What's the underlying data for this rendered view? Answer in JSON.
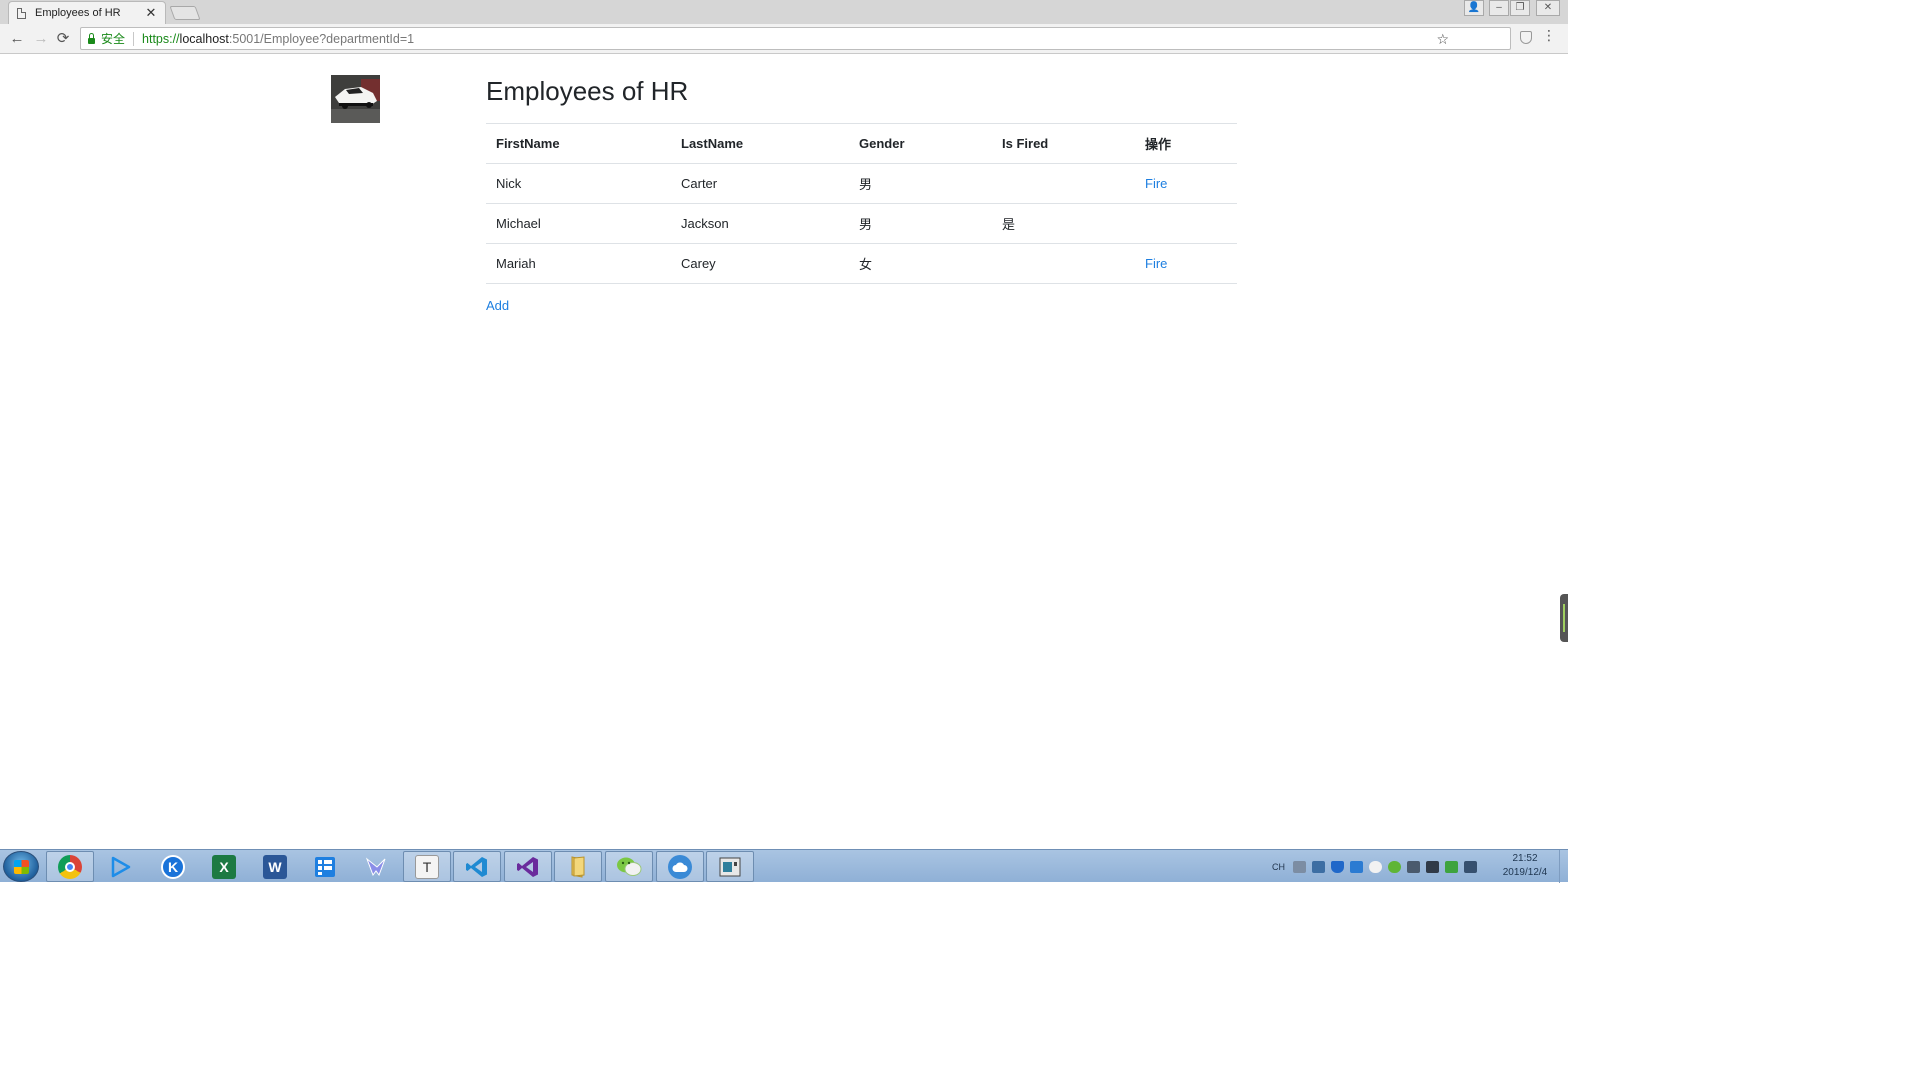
{
  "browser": {
    "tab_title": "Employees of HR",
    "tab_close": "✕",
    "secure_label": "安全",
    "url_scheme": "https://",
    "url_host": "localhost",
    "url_path": ":5001/Employee?departmentId=1",
    "back": "←",
    "forward": "→",
    "reload": "⟳",
    "star": "☆",
    "menu": "⋮",
    "window_controls": [
      "👤",
      "–",
      "❐",
      "✕"
    ]
  },
  "page": {
    "title": "Employees of HR",
    "table": {
      "headers": [
        "FirstName",
        "LastName",
        "Gender",
        "Is Fired",
        "操作"
      ],
      "rows": [
        {
          "first": "Nick",
          "last": "Carter",
          "gender": "男",
          "fired": "",
          "action": "Fire"
        },
        {
          "first": "Michael",
          "last": "Jackson",
          "gender": "男",
          "fired": "是",
          "action": ""
        },
        {
          "first": "Mariah",
          "last": "Carey",
          "gender": "女",
          "fired": "",
          "action": "Fire"
        }
      ]
    },
    "add_label": "Add"
  },
  "taskbar": {
    "apps": [
      "chrome-icon",
      "play-icon",
      "k-icon",
      "excel-icon",
      "word-icon",
      "sidebar-app-icon",
      "bird-icon",
      "typora-icon",
      "vscode-icon",
      "visual-studio-icon",
      "folder-icon",
      "wechat-icon",
      "cloud-icon",
      "window-app-icon"
    ],
    "excel_letter": "X",
    "word_letter": "W",
    "k_letter": "K",
    "typora_letter": "T",
    "lang": "CH",
    "time": "21:52",
    "date": "2019/12/4"
  },
  "colors": {
    "link": "#1e7fe0",
    "secure": "#1a8a1a",
    "excel": "#1d7a43",
    "word": "#2b5797",
    "vscode": "#1f8ad2",
    "visual_studio": "#6a2b9c"
  }
}
